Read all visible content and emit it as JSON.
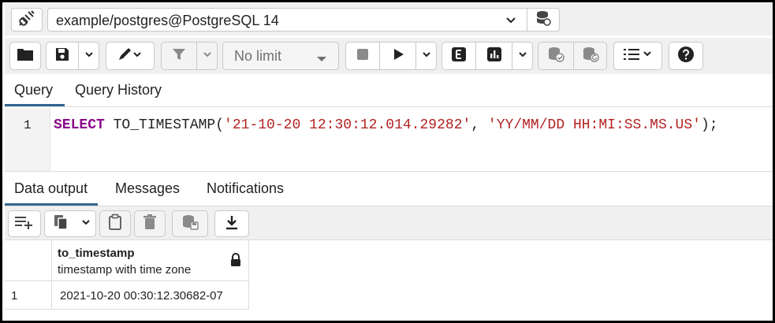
{
  "connection": {
    "label": "example/postgres@PostgreSQL 14",
    "icon": "connection-plug-icon",
    "db_icon": "database-stack-icon"
  },
  "toolbar": {
    "buttons": [
      {
        "name": "open-file",
        "icon": "folder-icon"
      },
      {
        "name": "save-file",
        "icon": "save-icon"
      },
      {
        "name": "edit",
        "icon": "pencil-icon"
      },
      {
        "name": "filter",
        "icon": "filter-icon"
      },
      {
        "name": "stop",
        "icon": "stop-icon"
      },
      {
        "name": "execute",
        "icon": "play-icon"
      },
      {
        "name": "explain",
        "icon": "explain-icon",
        "glyph": "E"
      },
      {
        "name": "explain-analyze",
        "icon": "chart-icon"
      },
      {
        "name": "commit",
        "icon": "commit-icon"
      },
      {
        "name": "rollback",
        "icon": "rollback-icon"
      },
      {
        "name": "macros",
        "icon": "list-icon"
      },
      {
        "name": "help",
        "icon": "help-icon",
        "glyph": "?"
      }
    ],
    "limit_label": "No limit"
  },
  "query_tabs": [
    {
      "label": "Query",
      "active": true
    },
    {
      "label": "Query History",
      "active": false
    }
  ],
  "editor": {
    "line_number": "1",
    "tokens": {
      "kw": "SELECT",
      "fn": " TO_TIMESTAMP(",
      "arg1": "'21-10-20 12:30:12.014.29282'",
      "comma": ", ",
      "arg2": "'YY/MM/DD HH:MI:SS.MS.US'",
      "end": ");"
    }
  },
  "output_tabs": [
    {
      "label": "Data output",
      "active": true
    },
    {
      "label": "Messages",
      "active": false
    },
    {
      "label": "Notifications",
      "active": false
    }
  ],
  "output_toolbar": {
    "buttons": [
      {
        "name": "add-row",
        "icon": "add-row-icon"
      },
      {
        "name": "copy",
        "icon": "copy-icon"
      },
      {
        "name": "paste",
        "icon": "paste-icon"
      },
      {
        "name": "delete",
        "icon": "trash-icon"
      },
      {
        "name": "save-data",
        "icon": "save-data-icon"
      },
      {
        "name": "download",
        "icon": "download-icon"
      }
    ]
  },
  "result": {
    "columns": [
      {
        "name": "to_timestamp",
        "type": "timestamp with time zone",
        "locked": true
      }
    ],
    "rows": [
      {
        "row_number": "1",
        "cells": [
          "2021-10-20 00:30:12.30682-07"
        ]
      }
    ]
  },
  "colors": {
    "keyword": "#8b0a8b",
    "string": "#b22222",
    "tab_accent": "#326690",
    "toolbar_bg": "#f0f0f0"
  }
}
